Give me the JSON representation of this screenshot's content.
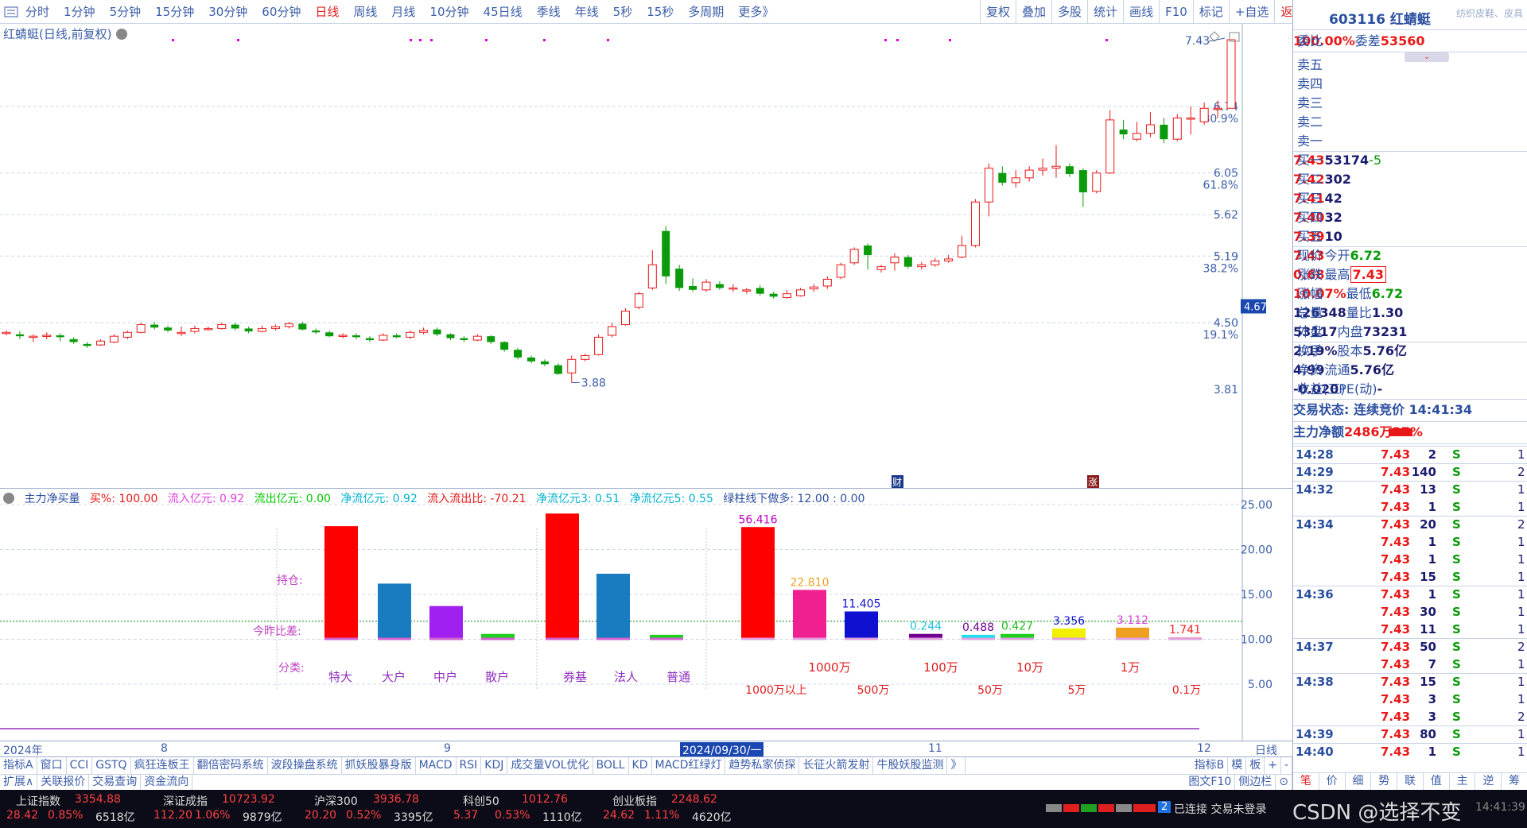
{
  "periods": [
    "分时",
    "1分钟",
    "5分钟",
    "15分钟",
    "30分钟",
    "60分钟",
    "日线",
    "周线",
    "月线",
    "10分钟",
    "45日线",
    "季线",
    "年线",
    "5秒",
    "15秒",
    "多周期",
    "更多》"
  ],
  "active_period": "日线",
  "toolbar_right": [
    "复权",
    "叠加",
    "多股",
    "统计",
    "画线",
    "F10",
    "标记",
    "+自选",
    "返回"
  ],
  "chart_title": "红蜻蜓(日线,前复权)",
  "price_axis": [
    "7.43",
    "6.74",
    "80.9%",
    "6.05",
    "61.8%",
    "5.62",
    "5.19",
    "38.2%",
    "4.67",
    "4.50",
    "19.1%",
    "3.81"
  ],
  "price_labels": {
    "high": "7.43",
    "low": "3.88"
  },
  "markers": {
    "cai": "财",
    "zhang": "涨"
  },
  "indicator_title": {
    "name": "主力净买量",
    "buy_pct": "买%: 100.00",
    "inflow": "流入亿元: 0.92",
    "outflow": "流出亿元: 0.00",
    "net_inflow": "净流亿元: 0.92",
    "ratio": "流入流出比: -70.21",
    "net3": "净流亿元3: 0.51",
    "net5": "净流亿元5: 0.55",
    "green_line": "绿柱线下做多: 12.00 : 0.00"
  },
  "indicator_axis": [
    "25.00",
    "20.00",
    "15.00",
    "10.00",
    "5.00"
  ],
  "indicator_labels": {
    "chicang": "持仓:",
    "today_diff": "今昨比差:",
    "category": "分类:",
    "groups": [
      "特大",
      "大户",
      "中户",
      "散户",
      "券基",
      "法人",
      "普通"
    ],
    "amount_tiers": [
      "1000万",
      "100万",
      "10万",
      "1万"
    ],
    "amount_tiers2": [
      "1000万以上",
      "500万",
      "50万",
      "5万",
      "0.1万"
    ],
    "bar_values": [
      "56.416",
      "22.810",
      "11.405",
      "0.244",
      "0.488",
      "0.427",
      "3.356",
      "3.112",
      "1.741"
    ]
  },
  "date_axis": [
    "2024年",
    "8",
    "9",
    "2024/09/30/一",
    "11",
    "12",
    "日线"
  ],
  "indicator_tabs": [
    "指标A",
    "窗口",
    "CCI",
    "GSTQ",
    "疯狂连板王",
    "翻倍密码系统",
    "波段操盘系统",
    "抓妖股暴身版",
    "MACD",
    "RSI",
    "KDJ",
    "成交量VOL优化",
    "BOLL",
    "KD",
    "MACD红绿灯",
    "趋势私家侦探",
    "长征火箭发射",
    "牛股妖股监测",
    "》"
  ],
  "indicator_tabs_right": [
    "指标B",
    "模",
    "板",
    "+",
    "-"
  ],
  "bottom_tabs": [
    "扩展∧",
    "关联报价",
    "交易查询",
    "资金流向"
  ],
  "bottom_tabs_right": [
    "图文F10",
    "侧边栏",
    "⊙"
  ],
  "stock": {
    "code": "603116",
    "name": "红蜻蜓",
    "sub": "纺织皮鞋、皮具",
    "weibi_label": "委比",
    "weibi": "100.00%",
    "weicha_label": "委差",
    "weicha": "53560",
    "sell": [
      {
        "label": "卖五"
      },
      {
        "label": "卖四"
      },
      {
        "label": "卖三"
      },
      {
        "label": "卖二"
      },
      {
        "label": "卖一"
      }
    ],
    "buy": [
      {
        "label": "买一",
        "price": "7.43",
        "vol": "53174",
        "chg": "-5"
      },
      {
        "label": "买二",
        "price": "7.42",
        "vol": "302",
        "chg": ""
      },
      {
        "label": "买三",
        "price": "7.41",
        "vol": "42",
        "chg": ""
      },
      {
        "label": "买四",
        "price": "7.40",
        "vol": "32",
        "chg": ""
      },
      {
        "label": "买五",
        "price": "7.39",
        "vol": "10",
        "chg": ""
      }
    ],
    "quote": [
      {
        "l1": "现价",
        "v1": "7.43",
        "l2": "今开",
        "v2": "6.72"
      },
      {
        "l1": "涨跌",
        "v1": "0.68",
        "l2": "最高",
        "v2": "7.43"
      },
      {
        "l1": "涨幅",
        "v1": "10.07%",
        "l2": "最低",
        "v2": "6.72"
      },
      {
        "l1": "总量",
        "v1": "126348",
        "l2": "量比",
        "v2": "1.30"
      },
      {
        "l1": "外盘",
        "v1": "53117",
        "l2": "内盘",
        "v2": "73231"
      },
      {
        "l1": "换手",
        "v1": "2.19%",
        "l2": "股本",
        "v2": "5.76亿"
      },
      {
        "l1": "净资",
        "v1": "4.99",
        "l2": "流通",
        "v2": "5.76亿"
      },
      {
        "l1": "收益(三)",
        "v1": "-0.020",
        "l2": "PE(动)",
        "v2": "-"
      }
    ],
    "trade_status": "交易状态: 连续竞价 14:41:34",
    "main_net_label": "主力净额",
    "main_net_value": "2486万",
    "main_net_pct": "27%"
  },
  "ticks": [
    {
      "t": "14:28",
      "p": "7.43",
      "v": "2",
      "s": "S",
      "n": "1"
    },
    {
      "t": "14:29",
      "p": "7.43",
      "v": "140",
      "s": "S",
      "n": "2"
    },
    {
      "t": "14:32",
      "p": "7.43",
      "v": "13",
      "s": "S",
      "n": "1"
    },
    {
      "t": "",
      "p": "7.43",
      "v": "1",
      "s": "S",
      "n": "1"
    },
    {
      "t": "14:34",
      "p": "7.43",
      "v": "20",
      "s": "S",
      "n": "2"
    },
    {
      "t": "",
      "p": "7.43",
      "v": "1",
      "s": "S",
      "n": "1"
    },
    {
      "t": "",
      "p": "7.43",
      "v": "1",
      "s": "S",
      "n": "1"
    },
    {
      "t": "",
      "p": "7.43",
      "v": "15",
      "s": "S",
      "n": "1"
    },
    {
      "t": "14:36",
      "p": "7.43",
      "v": "1",
      "s": "S",
      "n": "1"
    },
    {
      "t": "",
      "p": "7.43",
      "v": "30",
      "s": "S",
      "n": "1"
    },
    {
      "t": "",
      "p": "7.43",
      "v": "11",
      "s": "S",
      "n": "1"
    },
    {
      "t": "14:37",
      "p": "7.43",
      "v": "50",
      "s": "S",
      "n": "2"
    },
    {
      "t": "",
      "p": "7.43",
      "v": "7",
      "s": "S",
      "n": "1"
    },
    {
      "t": "14:38",
      "p": "7.43",
      "v": "15",
      "s": "S",
      "n": "1"
    },
    {
      "t": "",
      "p": "7.43",
      "v": "3",
      "s": "S",
      "n": "1"
    },
    {
      "t": "",
      "p": "7.43",
      "v": "3",
      "s": "S",
      "n": "2"
    },
    {
      "t": "14:39",
      "p": "7.43",
      "v": "80",
      "s": "S",
      "n": "1"
    },
    {
      "t": "14:40",
      "p": "7.43",
      "v": "1",
      "s": "S",
      "n": "1"
    }
  ],
  "rp_tabs": [
    "笔",
    "价",
    "细",
    "势",
    "联",
    "值",
    "主",
    "逆",
    "筹"
  ],
  "market": [
    {
      "name": "上证指数",
      "value": "3354.88",
      "chg": "28.42",
      "pct": "0.85%",
      "amt": "6518亿"
    },
    {
      "name": "深证成指",
      "value": "10723.92",
      "chg": "112.20",
      "pct": "1.06%",
      "amt": "9879亿"
    },
    {
      "name": "沪深300",
      "value": "3936.78",
      "chg": "20.20",
      "pct": "0.52%",
      "amt": "3395亿"
    },
    {
      "name": "科创50",
      "value": "1012.76",
      "chg": "5.37",
      "pct": "0.53%",
      "amt": "1110亿"
    },
    {
      "name": "创业板指",
      "value": "2248.62",
      "chg": "24.62",
      "pct": "1.11%",
      "amt": "4620亿"
    }
  ],
  "connection": {
    "badge": "2",
    "text": "已连接 交易未登录",
    "time": "14:41:39"
  },
  "watermark": "CSDN @选择不变",
  "colors": {
    "up": "#e81818",
    "down": "#0a9a0a",
    "axis": "#3c5ea8",
    "bg": "#ffffff"
  }
}
